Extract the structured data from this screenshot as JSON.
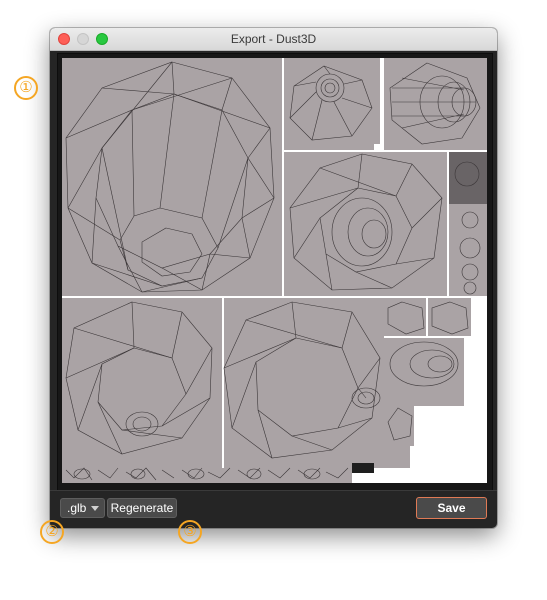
{
  "window": {
    "title": "Export - Dust3D"
  },
  "controls": {
    "format_value": ".glb",
    "regenerate_label": "Regenerate",
    "save_label": "Save"
  },
  "annotations": {
    "marker_1": "①",
    "marker_2": "②",
    "marker_3": "③"
  },
  "colors": {
    "accent": "#f5a623",
    "save_border": "#e07a55",
    "texture_fill": "#aaa3a5"
  },
  "icons": {
    "close": "traffic-light-close-icon",
    "minimize": "traffic-light-minimize-icon",
    "maximize": "traffic-light-maximize-icon",
    "dropdown": "chevron-down-icon"
  }
}
